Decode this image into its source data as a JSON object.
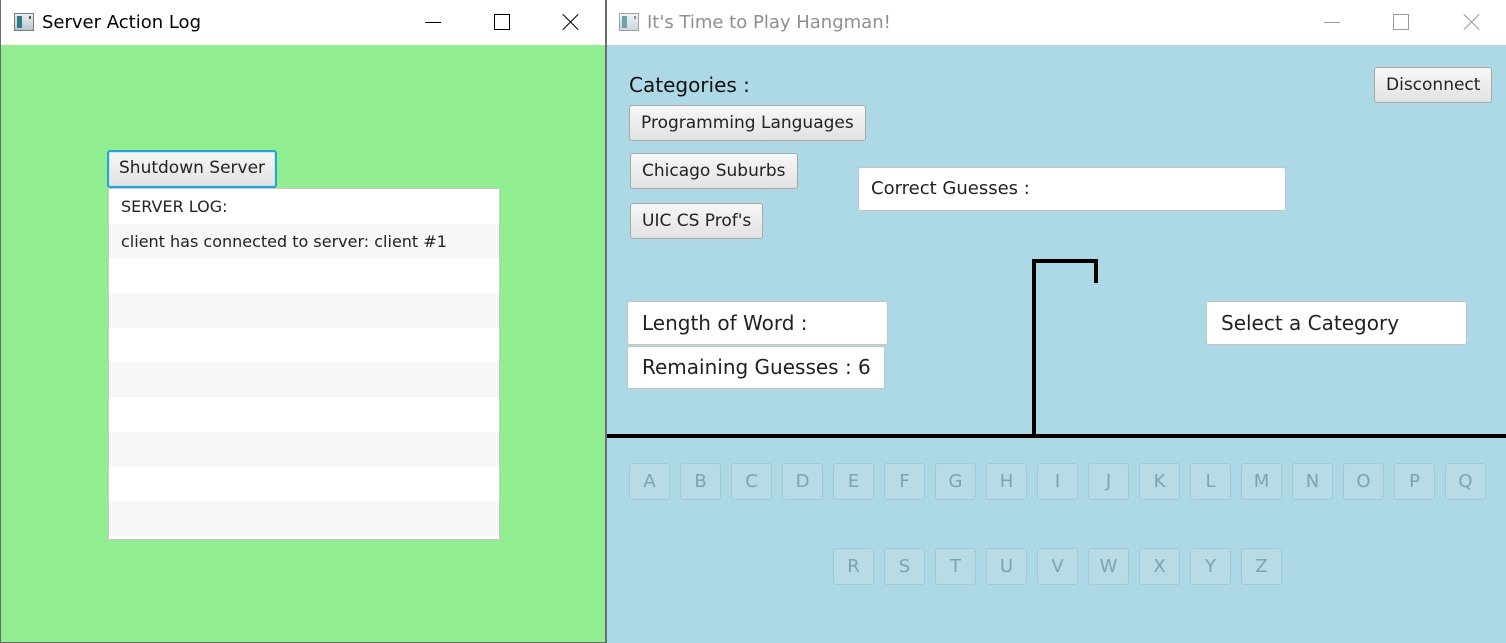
{
  "server_window": {
    "title": "Server Action Log",
    "icon": "java-app-icon",
    "shutdown_label": "Shutdown Server",
    "log": [
      "SERVER LOG:",
      "client has connected to server: client #1",
      "",
      "",
      "",
      "",
      "",
      "",
      "",
      ""
    ]
  },
  "game_window": {
    "title": "It's Time to Play Hangman!",
    "icon": "java-app-icon",
    "categories_label": "Categories :",
    "categories": [
      "Programming Languages",
      "Chicago Suburbs",
      "UIC CS Prof's"
    ],
    "disconnect_label": "Disconnect",
    "correct_guesses": "Correct Guesses :",
    "length_of_word": "Length of Word :",
    "remaining_guesses": "Remaining Guesses : 6",
    "status": "Select a Category",
    "letters_row1": [
      "A",
      "B",
      "C",
      "D",
      "E",
      "F",
      "G",
      "H",
      "I",
      "J",
      "K",
      "L",
      "M",
      "N",
      "O",
      "P",
      "Q"
    ],
    "letters_row2": [
      "R",
      "S",
      "T",
      "U",
      "V",
      "W",
      "X",
      "Y",
      "Z"
    ]
  },
  "colors": {
    "server_bg": "#90ee90",
    "game_bg": "#add8e6",
    "focus_ring": "#2aa0d6"
  }
}
